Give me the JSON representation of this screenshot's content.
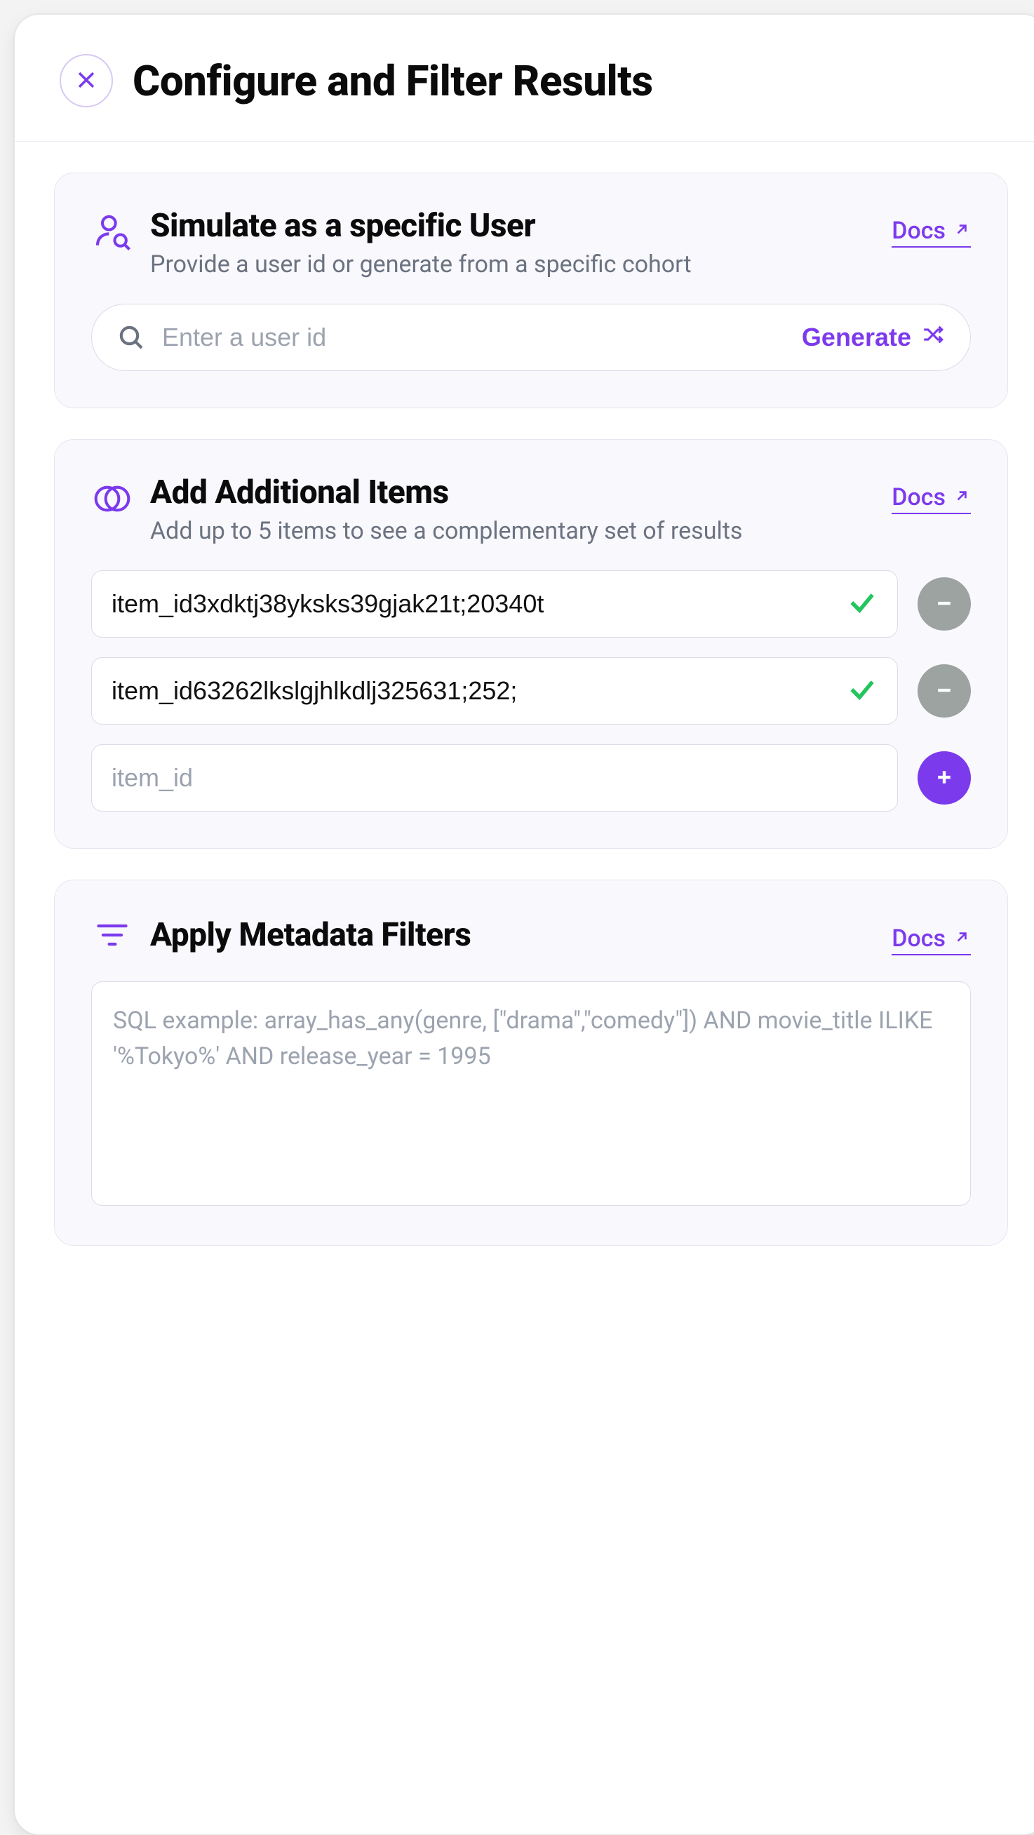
{
  "header": {
    "title": "Configure and Filter Results"
  },
  "docs_label": "Docs",
  "sections": {
    "simulate": {
      "title": "Simulate as a specific User",
      "subtitle": "Provide a user id or generate from a specific cohort",
      "placeholder": "Enter a user id",
      "value": "",
      "generate_label": "Generate"
    },
    "items": {
      "title": "Add Additional Items",
      "subtitle": "Add up to 5 items to see a complementary set of results",
      "rows": [
        {
          "value": "item_id3xdktj38yksks39gjak21t;20340t",
          "valid": true
        },
        {
          "value": "item_id63262lkslgjhlkdlj325631;252;",
          "valid": true
        }
      ],
      "new_placeholder": "item_id"
    },
    "filters": {
      "title": "Apply Metadata Filters",
      "placeholder": "SQL example: array_has_any(genre, [\"drama\",\"comedy\"]) AND movie_title ILIKE '%Tokyo%' AND release_year = 1995",
      "value": ""
    }
  }
}
